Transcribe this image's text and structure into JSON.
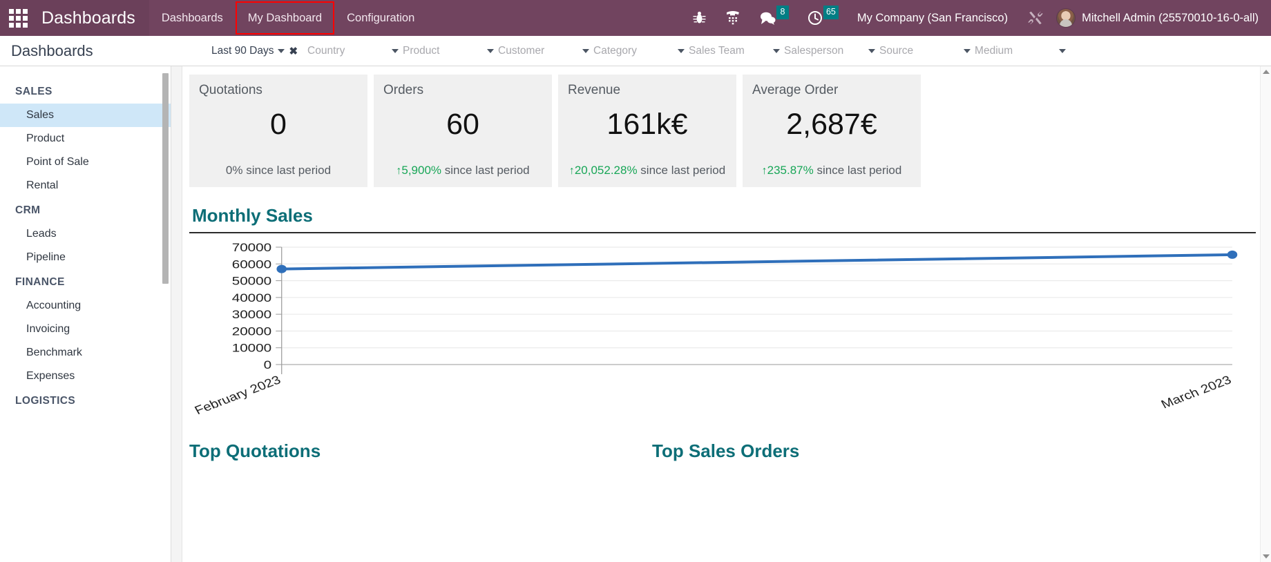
{
  "navbar": {
    "apps_icon": "grid-apps-icon",
    "brand": "Dashboards",
    "menu": [
      {
        "label": "Dashboards",
        "active": false
      },
      {
        "label": "My Dashboard",
        "active": true
      },
      {
        "label": "Configuration",
        "active": false
      }
    ],
    "icons": [
      {
        "name": "bug-icon",
        "badge": null
      },
      {
        "name": "phone-dialpad-icon",
        "badge": null
      },
      {
        "name": "messages-icon",
        "badge": "8"
      },
      {
        "name": "activities-clock-icon",
        "badge": "65"
      }
    ],
    "company": "My Company (San Francisco)",
    "tools_icon": "wrench-tools-icon",
    "user": "Mitchell Admin (25570010-16-0-all)",
    "badge_color": "#017e84",
    "bg_color": "#71445f",
    "highlight_color": "#ff0000"
  },
  "subheader": {
    "page_title": "Dashboards",
    "active_filter": {
      "label": "Last 90 Days",
      "clear": "✖"
    },
    "filter_placeholders": [
      "Country",
      "Product",
      "Customer",
      "Category",
      "Sales Team",
      "Salesperson",
      "Source",
      "Medium"
    ]
  },
  "sidebar": {
    "groups": [
      {
        "label": "SALES",
        "items": [
          {
            "label": "Sales",
            "active": true
          },
          {
            "label": "Product",
            "active": false
          },
          {
            "label": "Point of Sale",
            "active": false
          },
          {
            "label": "Rental",
            "active": false
          }
        ]
      },
      {
        "label": "CRM",
        "items": [
          {
            "label": "Leads",
            "active": false
          },
          {
            "label": "Pipeline",
            "active": false
          }
        ]
      },
      {
        "label": "FINANCE",
        "items": [
          {
            "label": "Accounting",
            "active": false
          },
          {
            "label": "Invoicing",
            "active": false
          },
          {
            "label": "Benchmark",
            "active": false
          },
          {
            "label": "Expenses",
            "active": false
          }
        ]
      },
      {
        "label": "LOGISTICS",
        "items": []
      }
    ],
    "active_color": "#cfe7f8"
  },
  "kpis": [
    {
      "title": "Quotations",
      "value": "0",
      "delta": "0%",
      "delta_suffix": " since last period",
      "direction": "none"
    },
    {
      "title": "Orders",
      "value": "60",
      "delta": "5,900%",
      "delta_suffix": " since last period",
      "direction": "up"
    },
    {
      "title": "Revenue",
      "value": "161k€",
      "delta": "20,052.28%",
      "delta_suffix": " since last period",
      "direction": "up"
    },
    {
      "title": "Average Order",
      "value": "2,687€",
      "delta": "235.87%",
      "delta_suffix": " since last period",
      "direction": "up"
    }
  ],
  "sections": {
    "monthly_sales": "Monthly Sales",
    "top_quotations": "Top Quotations",
    "top_sales_orders": "Top Sales Orders"
  },
  "chart_data": {
    "type": "line",
    "title": "Monthly Sales",
    "x": [
      "February 2023",
      "March 2023"
    ],
    "categories": [
      "February 2023",
      "March 2023"
    ],
    "series": [
      {
        "name": "Monthly Sales",
        "values": [
          57000,
          65500
        ],
        "color": "#2f6fba"
      }
    ],
    "values": [
      57000,
      65500
    ],
    "yticks": [
      0,
      10000,
      20000,
      30000,
      40000,
      50000,
      60000,
      70000
    ],
    "ytick_labels": [
      "0",
      "10000",
      "20000",
      "30000",
      "40000",
      "50000",
      "60000",
      "70000"
    ],
    "ylim": [
      0,
      70000
    ],
    "xlabel": "",
    "ylabel": "",
    "grid": true,
    "legend": false,
    "xtick_rotation": -25,
    "marker": "circle",
    "line_width": 4
  },
  "colors": {
    "teal_heading": "#0d6e77",
    "line_blue": "#2f6fba",
    "green": "#18a657",
    "card_bg": "#f0f0f0"
  }
}
